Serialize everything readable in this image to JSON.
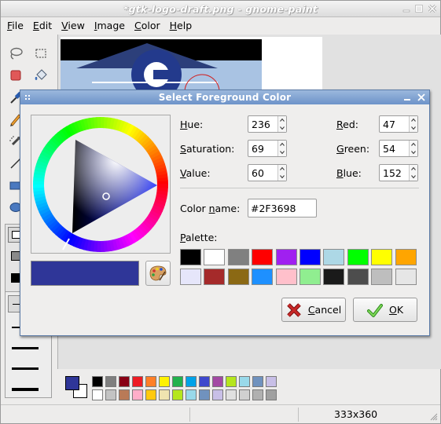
{
  "app": {
    "title": "*gtk-logo-draft.png - gnome-paint",
    "menus": [
      {
        "pre": "",
        "ul": "F",
        "post": "ile"
      },
      {
        "pre": "",
        "ul": "E",
        "post": "dit"
      },
      {
        "pre": "",
        "ul": "V",
        "post": "iew"
      },
      {
        "pre": "",
        "ul": "I",
        "post": "mage"
      },
      {
        "pre": "",
        "ul": "C",
        "post": "olor"
      },
      {
        "pre": "",
        "ul": "H",
        "post": "elp"
      }
    ],
    "foreground_color": "#2F3698",
    "background_color": "#FFFFFF",
    "palette": [
      "#000000",
      "#7f7f7f",
      "#880015",
      "#ed1c24",
      "#ff7f27",
      "#fff200",
      "#22b14c",
      "#00a2e8",
      "#3f48cc",
      "#a349a4",
      "#b5e61d",
      "#99d9ea",
      "#7092be",
      "#c8bfe7",
      "#ffffff",
      "#c3c3c3",
      "#b97a57",
      "#ffaec9",
      "#ffc90e",
      "#efe4b0",
      "#b5e61d",
      "#99d9ea",
      "#7092be",
      "#c8bfe7",
      "#e0e0e0",
      "#d0d0d0",
      "#b0b0b0",
      "#a0a0a0"
    ],
    "status_size": "333x360"
  },
  "dialog": {
    "title": "Select Foreground Color",
    "hue": {
      "pre": "",
      "ul": "H",
      "post": "ue:",
      "value": "236"
    },
    "saturation": {
      "pre": "",
      "ul": "S",
      "post": "aturation:",
      "value": "69"
    },
    "value": {
      "pre": "",
      "ul": "V",
      "post": "alue:",
      "value": "60"
    },
    "red": {
      "pre": "",
      "ul": "R",
      "post": "ed:",
      "value": "47"
    },
    "green": {
      "pre": "",
      "ul": "G",
      "post": "reen:",
      "value": "54"
    },
    "blue": {
      "pre": "",
      "ul": "B",
      "post": "lue:",
      "value": "152"
    },
    "color_name": {
      "pre": "Color ",
      "ul": "n",
      "post": "ame:",
      "value": "#2F3698"
    },
    "palette_label": {
      "pre": "",
      "ul": "P",
      "post": "alette:"
    },
    "current_color": "#2F3698",
    "palette": [
      "#000000",
      "#ffffff",
      "#808080",
      "#ff0000",
      "#a020f0",
      "#0000ff",
      "#add8e6",
      "#00ff00",
      "#ffff00",
      "#ffa500",
      "#e6e6fa",
      "#a52a2a",
      "#8b6914",
      "#1e90ff",
      "#ffc0cb",
      "#90ee90",
      "#1a1a1a",
      "#4d4d4d",
      "#bebebe",
      "#e6e6e6"
    ],
    "cancel": {
      "pre": "",
      "ul": "C",
      "post": "ancel"
    },
    "ok": {
      "pre": "",
      "ul": "O",
      "post": "K"
    }
  }
}
